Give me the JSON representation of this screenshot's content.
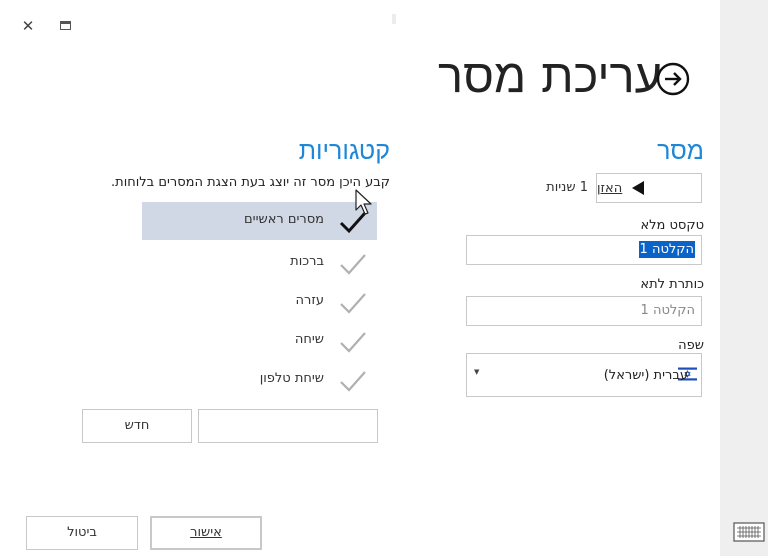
{
  "window": {
    "close_glyph": "✕"
  },
  "header": {
    "title": "עריכת מסר"
  },
  "message": {
    "heading": "מסר",
    "listen_label": "האזן",
    "duration": "1 שניות",
    "full_text_label": "טקסט מלא",
    "full_text_value": "הקלטה 1",
    "caption_label": "כותרת לתא",
    "caption_placeholder": "הקלטה 1",
    "language_label": "שפה",
    "language_value": "עברית (ישראל)"
  },
  "categories": {
    "heading": "קטגוריות",
    "instructions": "קבע היכן מסר זה יוצג בעת הצגת המסרים בלוחות.",
    "items": [
      {
        "label": "מסרים ראשיים",
        "selected": true
      },
      {
        "label": "ברכות",
        "selected": false
      },
      {
        "label": "עזרה",
        "selected": false
      },
      {
        "label": "שיחה",
        "selected": false
      },
      {
        "label": "שיחת טלפון",
        "selected": false
      }
    ],
    "new_button": "חדש"
  },
  "footer": {
    "ok_label": "אישור",
    "cancel_label": "ביטול"
  },
  "colors": {
    "accent": "#1e87d7",
    "selected_row": "#d0d8e5",
    "check_selected": "#111111",
    "check_unselected": "#b0b0b0"
  },
  "icons": {
    "close": "close-icon",
    "restore": "restore-window-icon",
    "back": "back-arrow-circle-icon",
    "play": "play-triangle-icon",
    "flag": "israel-flag-icon",
    "check": "checkmark-icon",
    "keyboard": "keyboard-icon",
    "cursor": "mouse-pointer-icon"
  }
}
